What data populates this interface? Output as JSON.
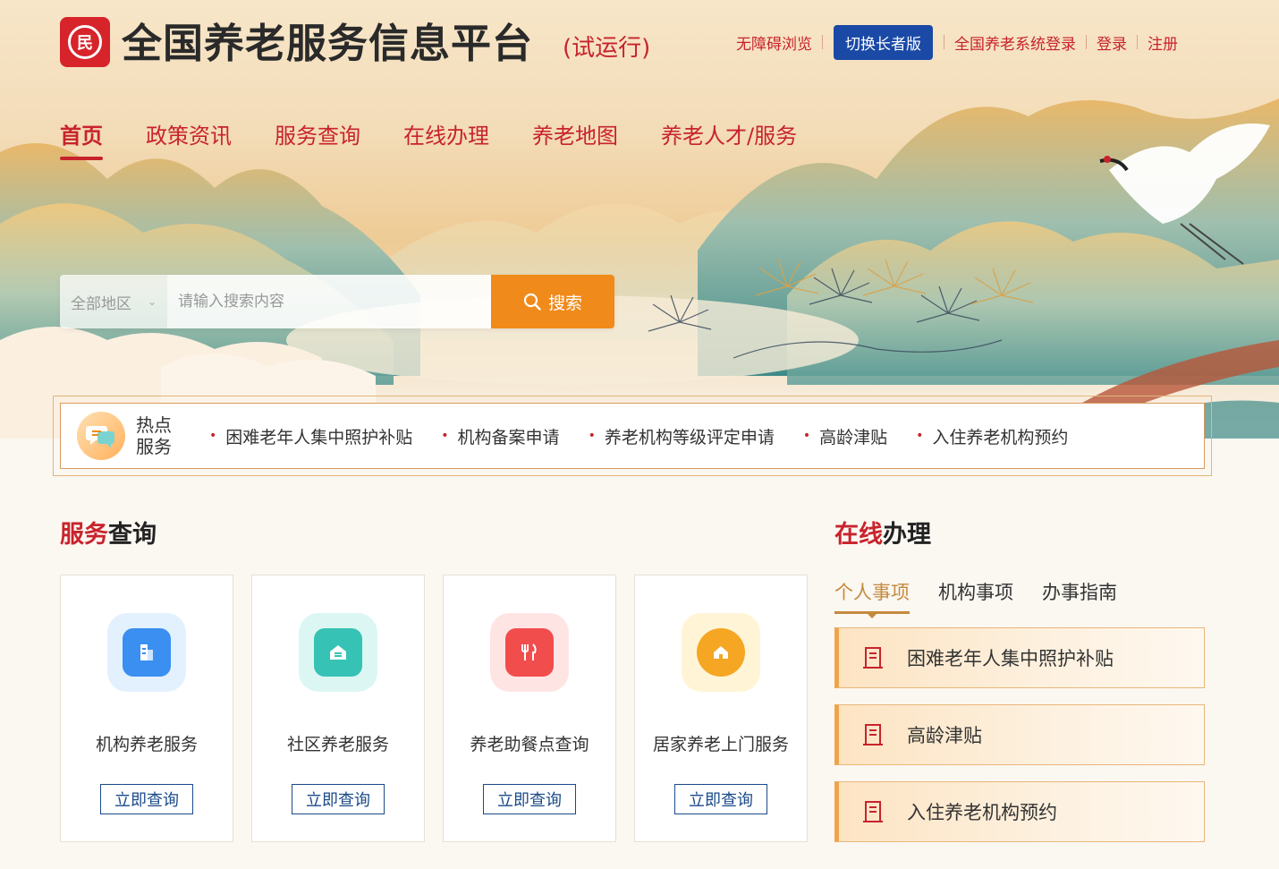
{
  "header": {
    "title": "全国养老服务信息平台",
    "subtitle": "(试运行)",
    "links": {
      "accessible": "无障碍浏览",
      "elder_mode": "切换长者版",
      "system_login": "全国养老系统登录",
      "login": "登录",
      "register": "注册"
    }
  },
  "nav": {
    "items": [
      "首页",
      "政策资讯",
      "服务查询",
      "在线办理",
      "养老地图",
      "养老人才/服务"
    ],
    "active": "首页"
  },
  "search": {
    "region": "全部地区",
    "placeholder": "请输入搜索内容",
    "button": "搜索"
  },
  "hot_services": {
    "title_line1": "热点",
    "title_line2": "服务",
    "items": [
      "困难老年人集中照护补贴",
      "机构备案申请",
      "养老机构等级评定申请",
      "高龄津贴",
      "入住养老机构预约"
    ]
  },
  "service_query": {
    "title_red": "服务",
    "title_rest": "查询",
    "cards": [
      {
        "label": "机构养老服务",
        "button": "立即查询",
        "icon": "building-icon",
        "color": "#3a8ff0",
        "bg": "#e3f1ff"
      },
      {
        "label": "社区养老服务",
        "button": "立即查询",
        "icon": "community-icon",
        "color": "#36c2b4",
        "bg": "#dcf7f3"
      },
      {
        "label": "养老助餐点查询",
        "button": "立即查询",
        "icon": "dining-icon",
        "color": "#f24d4d",
        "bg": "#ffe4e4"
      },
      {
        "label": "居家养老上门服务",
        "button": "立即查询",
        "icon": "home-icon",
        "color": "#f5a623",
        "bg": "#fff5d6"
      }
    ]
  },
  "online": {
    "title_red": "在线",
    "title_rest": "办理",
    "tabs": [
      "个人事项",
      "机构事项",
      "办事指南"
    ],
    "active_tab": "个人事项",
    "items": [
      "困难老年人集中照护补贴",
      "高龄津贴",
      "入住养老机构预约"
    ]
  },
  "colors": {
    "brand_red": "#c8232c",
    "elder_blue": "#1a49a6",
    "search_orange": "#f08a1a",
    "tab_gold": "#c58a3e"
  }
}
